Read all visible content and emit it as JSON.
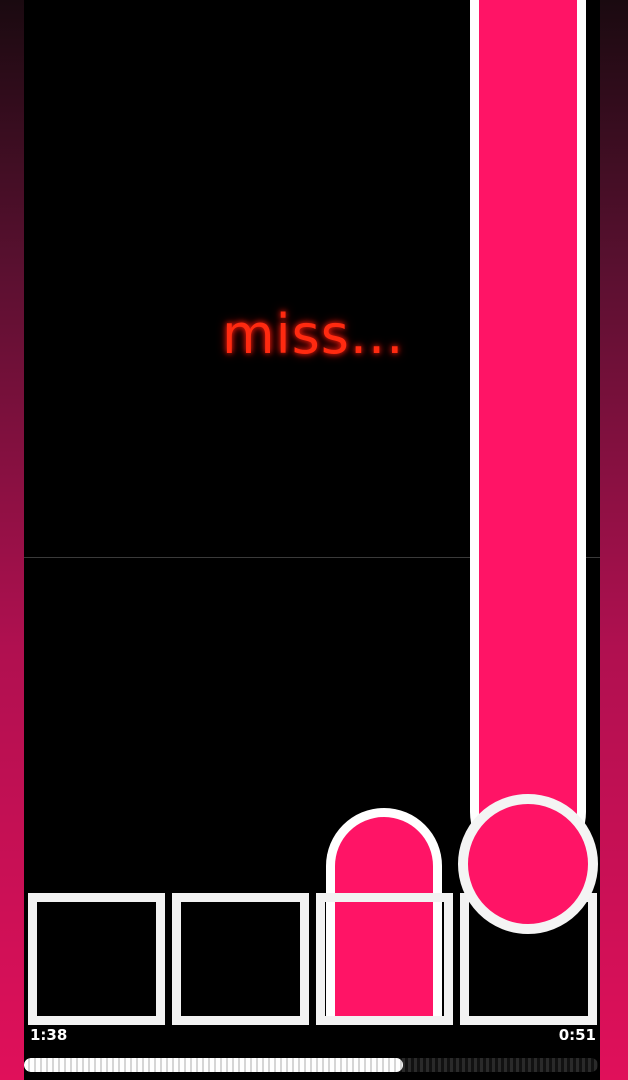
{
  "judgement": {
    "text": "miss..."
  },
  "timer": {
    "elapsed": "1:38",
    "remaining": "0:51"
  },
  "progress": {
    "fraction": 0.66
  },
  "lanes": [
    {
      "id": 1,
      "state": "idle"
    },
    {
      "id": 2,
      "state": "idle"
    },
    {
      "id": 3,
      "state": "hold"
    },
    {
      "id": 4,
      "state": "hold"
    }
  ],
  "colors": {
    "note": "#ff1466",
    "pad_border": "#f2f2f2",
    "judgement": "#ff2a10",
    "background": "#000000"
  }
}
